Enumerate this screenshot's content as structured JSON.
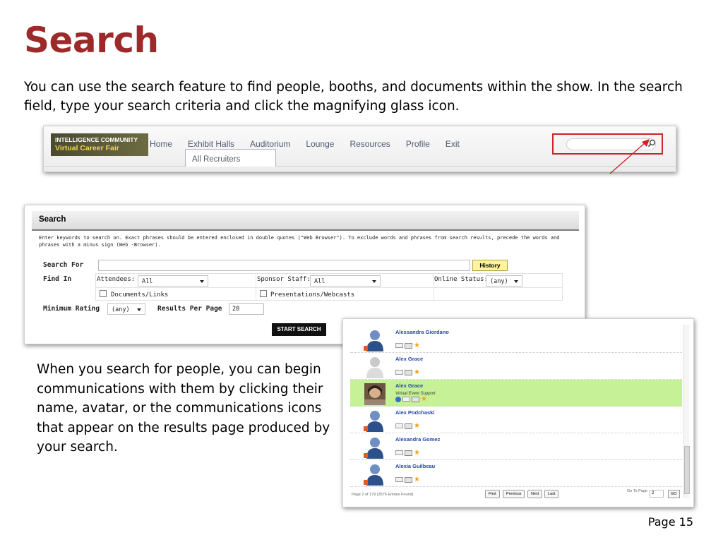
{
  "slide": {
    "title": "Search",
    "intro": "You can use the search feature to find people, booths, and documents within the show. In the search field, type your search criteria and click the magnifying glass icon.",
    "body": "When you search for people, you can begin communications with them by clicking their name, avatar, or the communications icons that appear on the results page produced by your search.",
    "page": "Page 15"
  },
  "nav": {
    "logo_line1": "INTELLIGENCE COMMUNITY",
    "logo_line2": "Virtual Career Fair",
    "items": [
      "Home",
      "Exhibit Halls",
      "Auditorium",
      "Lounge",
      "Resources",
      "Profile",
      "Exit"
    ],
    "submenu": "All Recruiters",
    "search_placeholder": ""
  },
  "search_form": {
    "title": "Search",
    "instructions": "Enter keywords to search on. Exact phrases should be entered enclosed in double quotes (\"Web Browser\"). To exclude words and phrases from search results, precede the words and phrases with a minus sign (Web -Browser).",
    "search_for_label": "Search For",
    "history_button": "History",
    "find_in_label": "Find In",
    "attendees_label": "Attendees:",
    "attendees_value": "All",
    "sponsor_staff_label": "Sponsor Staff:",
    "sponsor_staff_value": "All",
    "online_status_label": "Online Status:",
    "online_status_value": "(any)",
    "documents_label": "Documents/Links",
    "presentations_label": "Presentations/Webcasts",
    "min_rating_label": "Minimum Rating",
    "min_rating_value": "(any)",
    "results_per_page_label": "Results Per Page",
    "results_per_page_value": "20",
    "start_button": "START SEARCH"
  },
  "results": {
    "rows": [
      {
        "name": "Alessandra Giordano",
        "sub": "",
        "avatar": "default-blue",
        "highlight": false
      },
      {
        "name": "Alex Grace",
        "sub": "",
        "avatar": "default-gray",
        "highlight": false
      },
      {
        "name": "Alex Grace",
        "sub": "Virtual Event Support",
        "avatar": "photo",
        "highlight": true
      },
      {
        "name": "Alex Podchaski",
        "sub": "",
        "avatar": "default-blue",
        "highlight": false
      },
      {
        "name": "Alexandra Gomez",
        "sub": "",
        "avatar": "default-blue",
        "highlight": false
      },
      {
        "name": "Alexia Guilbeau",
        "sub": "",
        "avatar": "default-blue",
        "highlight": false
      }
    ],
    "footer_count": "Page 2 of 179 (3576 Entries Found)",
    "btn_first": "First",
    "btn_previous": "Previous",
    "btn_next": "Next",
    "btn_last": "Last",
    "goto_label": "Go To Page",
    "goto_value": "2",
    "go_button": "GO"
  }
}
